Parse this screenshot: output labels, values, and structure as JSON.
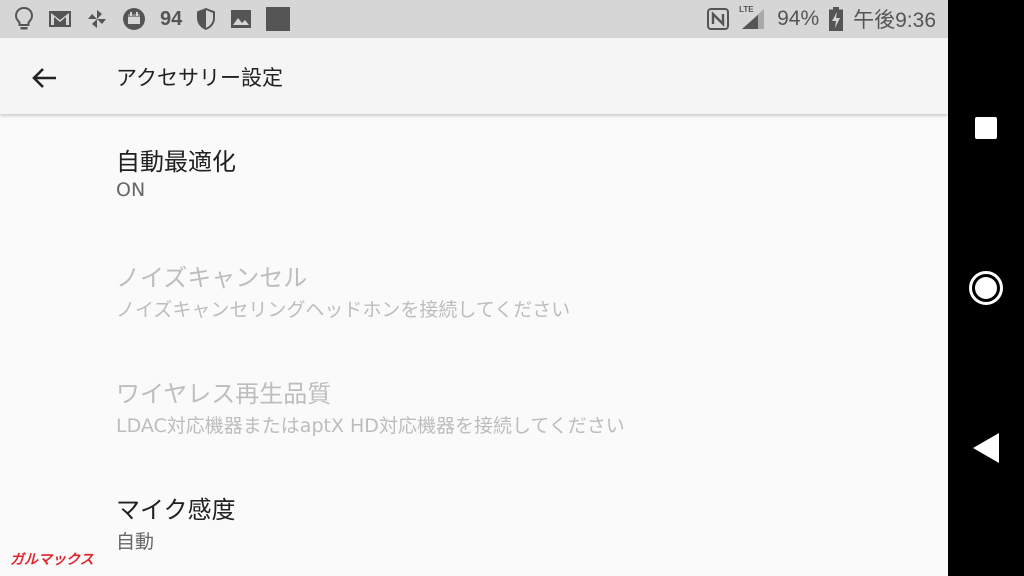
{
  "status_bar": {
    "left_icons": [
      "lightbulb-icon",
      "gmail-icon",
      "pinwheel-icon",
      "calendar-icon"
    ],
    "notification_count": "94",
    "more_icons": [
      "shield-icon",
      "image-icon",
      "square-icon"
    ],
    "right_icons": [
      "nfc-icon",
      "lte-signal-icon",
      "battery-charging-icon"
    ],
    "lte_label": "LTE",
    "battery_percent": "94%",
    "time": "午後9:36"
  },
  "app_bar": {
    "title": "アクセサリー設定",
    "back_icon": "arrow-back-icon"
  },
  "settings": [
    {
      "title": "自動最適化",
      "summary": "ON",
      "enabled": true
    },
    {
      "title": "ノイズキャンセル",
      "summary": "ノイズキャンセリングヘッドホンを接続してください",
      "enabled": false
    },
    {
      "title": "ワイヤレス再生品質",
      "summary": "LDAC対応機器またはaptX HD対応機器を接続してください",
      "enabled": false
    },
    {
      "title": "マイク感度",
      "summary": "自動",
      "enabled": true
    }
  ],
  "nav_bar": {
    "icons": [
      "recents-square-icon",
      "home-circle-icon",
      "back-triangle-icon"
    ]
  },
  "watermark": "ガルマックス",
  "colors": {
    "status_bar_bg": "#d6d6d6",
    "background": "#fafafa",
    "text_primary": "#212121",
    "text_secondary": "#666666",
    "text_disabled": "#bdbdbd",
    "nav_bar_bg": "#000000",
    "watermark": "#e0242c"
  }
}
